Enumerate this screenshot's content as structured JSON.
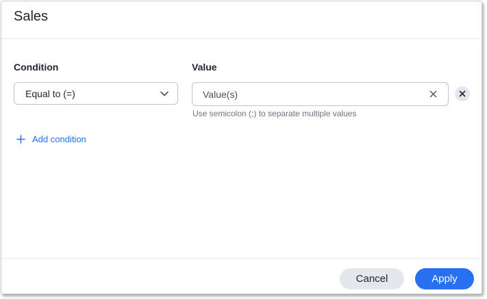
{
  "dialog": {
    "title": "Sales"
  },
  "condition": {
    "label": "Condition",
    "selected": "Equal to (=)"
  },
  "value": {
    "label": "Value",
    "placeholder": "Value(s)",
    "current": "",
    "helper": "Use semicolon (;) to separate multiple values"
  },
  "actions": {
    "add_condition": "Add condition",
    "cancel": "Cancel",
    "apply": "Apply"
  },
  "icons": {
    "select_chevron": "chevron-down-icon",
    "clear_value": "close-icon",
    "remove_condition": "close-icon",
    "add": "plus-icon"
  },
  "colors": {
    "accent": "#2770ef",
    "text": "#1d232f",
    "muted": "#6b7280",
    "secondary_button": "#e4e7eb"
  }
}
